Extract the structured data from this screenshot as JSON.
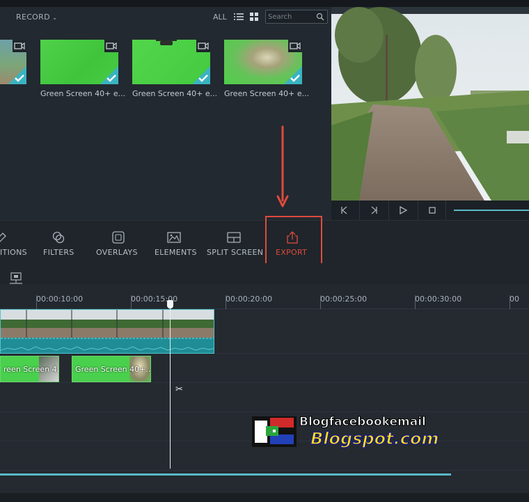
{
  "media": {
    "record_label": "RECORD",
    "filter_all": "ALL",
    "search_placeholder": "Search",
    "thumbnails": [
      {
        "label": ""
      },
      {
        "label": "Green Screen 40+ e..."
      },
      {
        "label": "Green Screen 40+ e..."
      },
      {
        "label": "Green Screen 40+ e..."
      }
    ]
  },
  "toolbar": {
    "items": [
      {
        "label": "ITIONS"
      },
      {
        "label": "FILTERS"
      },
      {
        "label": "OVERLAYS"
      },
      {
        "label": "ELEMENTS"
      },
      {
        "label": "SPLIT SCREEN"
      },
      {
        "label": "EXPORT"
      }
    ]
  },
  "timeline": {
    "ticks": [
      "00:00:10:00",
      "00:00:15:00",
      "00:00:20:00",
      "00:00:25:00",
      "00:00:30:00",
      "00"
    ],
    "clips": [
      {
        "label": "reen Screen 4..."
      },
      {
        "label": "Green Screen 40+..."
      }
    ]
  },
  "watermark": {
    "line1": "Blogfacebookemail",
    "line2": "Blogspot.com"
  },
  "colors": {
    "accent": "#58b9c7",
    "export_highlight": "#e04a3c",
    "green_screen": "#49d04d"
  }
}
